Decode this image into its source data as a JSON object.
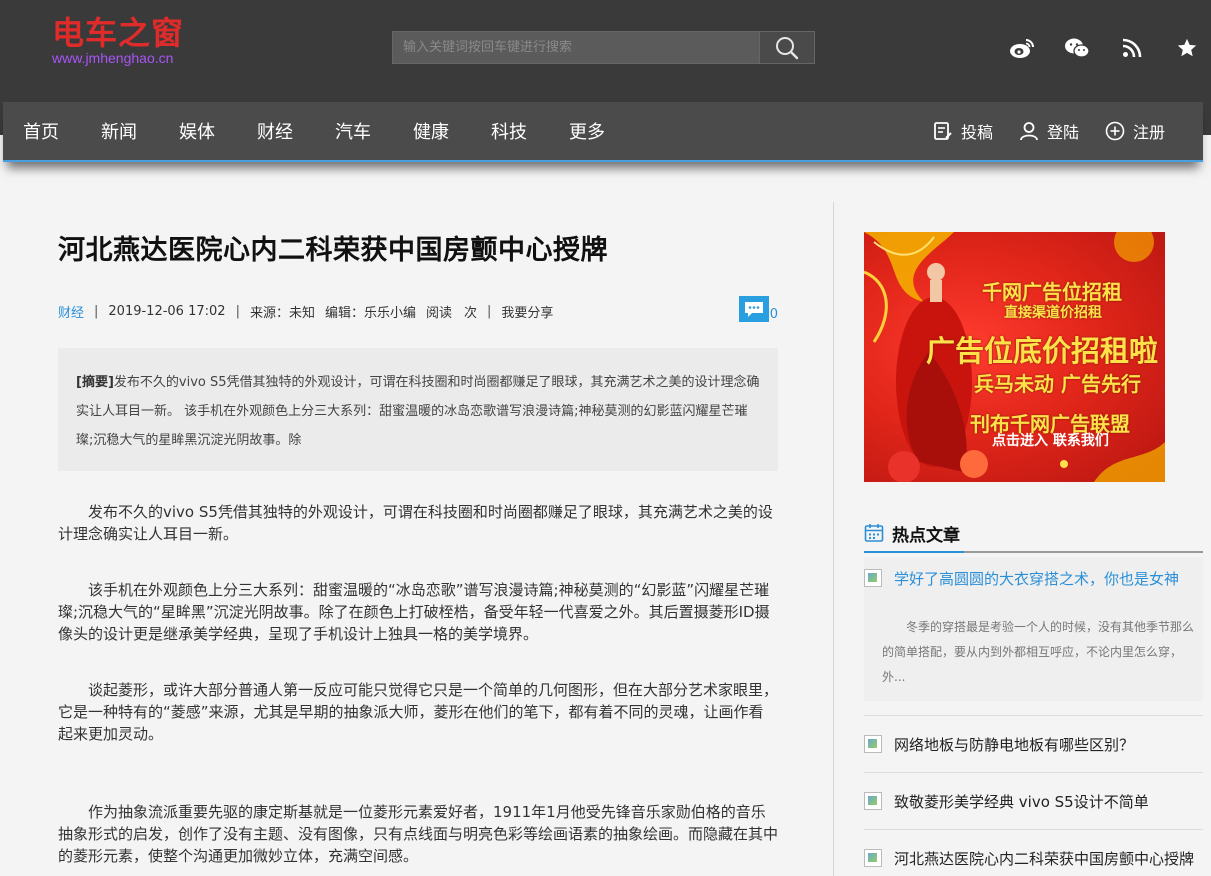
{
  "site": {
    "logo_title": "电车之窗",
    "logo_url": "www.jmhenghao.cn",
    "search_placeholder": "输入关键词按回车键进行搜索"
  },
  "nav": {
    "items": [
      "首页",
      "新闻",
      "娱体",
      "财经",
      "汽车",
      "健康",
      "科技",
      "更多"
    ],
    "submit": "投稿",
    "login": "登陆",
    "register": "注册"
  },
  "article": {
    "title": "河北燕达医院心内二科荣获中国房颤中心授牌",
    "category": "财经",
    "datetime": "2019-12-06 17:02",
    "source": "来源：未知",
    "editor": "编辑：乐乐小编",
    "reads": "阅读",
    "reads_unit": "次",
    "share": "我要分享",
    "comment_count": "0",
    "summary_label": "[摘要]",
    "summary": "发布不久的vivo S5凭借其独特的外观设计，可谓在科技圈和时尚圈都赚足了眼球，其充满艺术之美的设计理念确实让人耳目一新。 该手机在外观颜色上分三大系列：甜蜜温暖的冰岛恋歌谱写浪漫诗篇;神秘莫测的幻影蓝闪耀星芒璀璨;沉稳大气的星眸黑沉淀光阴故事。除",
    "paragraphs": [
      "发布不久的vivo S5凭借其独特的外观设计，可谓在科技圈和时尚圈都赚足了眼球，其充满艺术之美的设计理念确实让人耳目一新。",
      "该手机在外观颜色上分三大系列：甜蜜温暖的“冰岛恋歌”谱写浪漫诗篇;神秘莫测的“幻影蓝”闪耀星芒璀璨;沉稳大气的“星眸黑”沉淀光阴故事。除了在颜色上打破桎梏，备受年轻一代喜爱之外。其后置摄菱形ID摄像头的设计更是继承美学经典，呈现了手机设计上独具一格的美学境界。",
      "谈起菱形，或许大部分普通人第一反应可能只觉得它只是一个简单的几何图形，但在大部分艺术家眼里，它是一种特有的“菱感”来源，尤其是早期的抽象派大师，菱形在他们的笔下，都有着不同的灵魂，让画作看起来更加灵动。",
      "作为抽象流派重要先驱的康定斯基就是一位菱形元素爱好者，1911年1月他受先锋音乐家勋伯格的音乐抽象形式的启发，创作了没有主题、没有图像，只有点线面与明亮色彩等绘画语素的抽象绘画。而隐藏在其中的菱形元素，使整个沟通更加微妙立体，充满空间感。"
    ]
  },
  "ad": {
    "line1": "千网广告位招租",
    "line2": "直接渠道价招租",
    "line3": "广告位底价招租啦",
    "line4": "兵马未动 广告先行",
    "line5": "刊布千网广告联盟",
    "line6": "点击进入 联系我们"
  },
  "hot": {
    "title": "热点文章",
    "featured_title": "学好了高圆圆的大衣穿搭之术，你也是女神",
    "featured_desc": "冬季的穿搭最是考验一个人的时候，没有其他季节那么的简单搭配，要从内到外都相互呼应，不论内里怎么穿，外...",
    "items": [
      "网络地板与防静电地板有哪些区别？",
      "致敬菱形美学经典 vivo S5设计不简单",
      "河北燕达医院心内二科荣获中国房颤中心授牌"
    ]
  }
}
